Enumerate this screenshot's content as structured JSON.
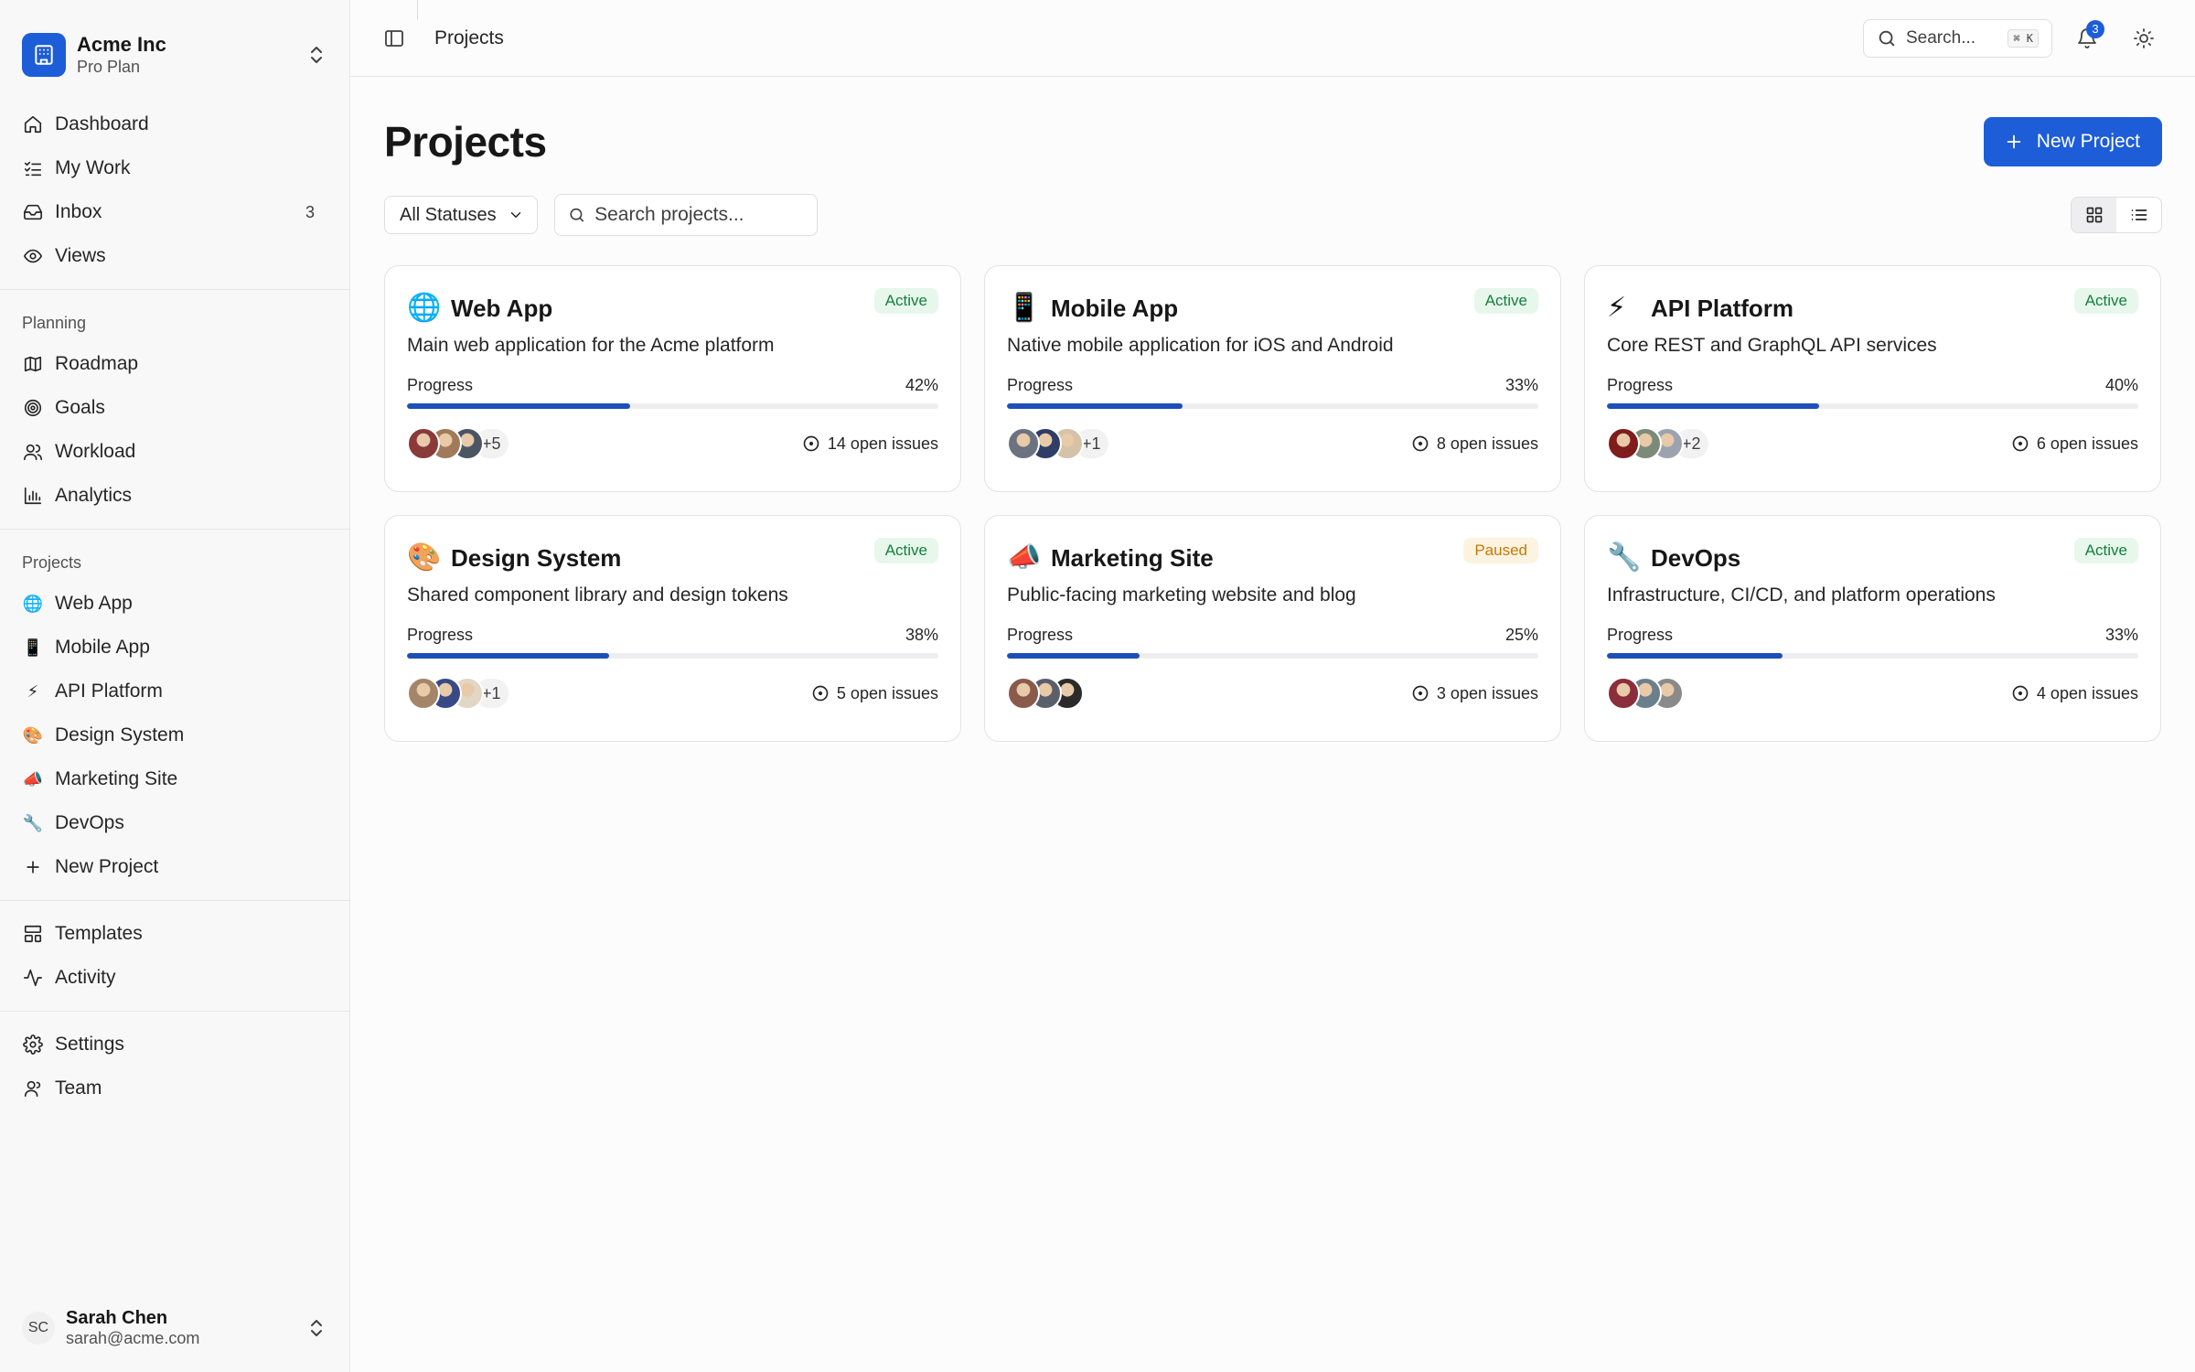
{
  "org": {
    "name": "Acme Inc",
    "plan": "Pro Plan"
  },
  "nav_main": [
    {
      "label": "Dashboard",
      "icon": "home-icon"
    },
    {
      "label": "My Work",
      "icon": "checklist-icon"
    },
    {
      "label": "Inbox",
      "icon": "inbox-icon",
      "count": "3"
    },
    {
      "label": "Views",
      "icon": "eye-icon"
    }
  ],
  "planning": {
    "label": "Planning",
    "items": [
      {
        "label": "Roadmap",
        "icon": "map-icon"
      },
      {
        "label": "Goals",
        "icon": "target-icon"
      },
      {
        "label": "Workload",
        "icon": "users-icon"
      },
      {
        "label": "Analytics",
        "icon": "bar-chart-icon"
      }
    ]
  },
  "projects_nav": {
    "label": "Projects",
    "items": [
      {
        "label": "Web App",
        "emoji": "🌐"
      },
      {
        "label": "Mobile App",
        "emoji": "📱"
      },
      {
        "label": "API Platform",
        "emoji": "⚡"
      },
      {
        "label": "Design System",
        "emoji": "🎨"
      },
      {
        "label": "Marketing Site",
        "emoji": "📣"
      },
      {
        "label": "DevOps",
        "emoji": "🔧"
      }
    ],
    "new_label": "New Project"
  },
  "nav_other": [
    {
      "label": "Templates",
      "icon": "templates-icon"
    },
    {
      "label": "Activity",
      "icon": "activity-icon"
    }
  ],
  "nav_settings": [
    {
      "label": "Settings",
      "icon": "gear-icon"
    },
    {
      "label": "Team",
      "icon": "team-icon"
    }
  ],
  "user": {
    "initials": "SC",
    "name": "Sarah Chen",
    "email": "sarah@acme.com"
  },
  "topbar": {
    "breadcrumb": "Projects",
    "search_label": "Search...",
    "search_shortcut": "⌘ K",
    "notification_count": "3"
  },
  "page": {
    "title": "Projects",
    "new_button": "New Project",
    "status_filter": "All Statuses",
    "search_placeholder": "Search projects...",
    "progress_label": "Progress"
  },
  "colors": {
    "accent": "#1d5dd8",
    "progress": "#1d4fb8",
    "active_bg": "#e7f7ec",
    "active_text": "#15803d",
    "paused_bg": "#fdf3e1",
    "paused_text": "#c2790b"
  },
  "projects": [
    {
      "emoji": "🌐",
      "name": "Web App",
      "status": "Active",
      "description": "Main web application for the Acme platform",
      "progress": 42,
      "progress_text": "42%",
      "members_more": "+5",
      "issues": "14 open issues",
      "avatar_colors": [
        "#8b3a3a",
        "#a07a5a",
        "#4b5563"
      ]
    },
    {
      "emoji": "📱",
      "name": "Mobile App",
      "status": "Active",
      "description": "Native mobile application for iOS and Android",
      "progress": 33,
      "progress_text": "33%",
      "members_more": "+1",
      "issues": "8 open issues",
      "avatar_colors": [
        "#6b7280",
        "#2f3e66",
        "#d6c2a8"
      ]
    },
    {
      "emoji": "⚡",
      "name": "API Platform",
      "status": "Active",
      "description": "Core REST and GraphQL API services",
      "progress": 40,
      "progress_text": "40%",
      "members_more": "+2",
      "issues": "6 open issues",
      "avatar_colors": [
        "#7f1d1d",
        "#7c8a7a",
        "#9ca3af"
      ]
    },
    {
      "emoji": "🎨",
      "name": "Design System",
      "status": "Active",
      "description": "Shared component library and design tokens",
      "progress": 38,
      "progress_text": "38%",
      "members_more": "+1",
      "issues": "5 open issues",
      "avatar_colors": [
        "#a3866a",
        "#384a85",
        "#e2d6c4"
      ]
    },
    {
      "emoji": "📣",
      "name": "Marketing Site",
      "status": "Paused",
      "description": "Public-facing marketing website and blog",
      "progress": 25,
      "progress_text": "25%",
      "members_more": "",
      "issues": "3 open issues",
      "avatar_colors": [
        "#8a5a4a",
        "#5a5f6b",
        "#2b2b2b"
      ]
    },
    {
      "emoji": "🔧",
      "name": "DevOps",
      "status": "Active",
      "description": "Infrastructure, CI/CD, and platform operations",
      "progress": 33,
      "progress_text": "33%",
      "members_more": "",
      "issues": "4 open issues",
      "avatar_colors": [
        "#8b2d3a",
        "#6b7f8a",
        "#8a8a8a"
      ]
    }
  ]
}
